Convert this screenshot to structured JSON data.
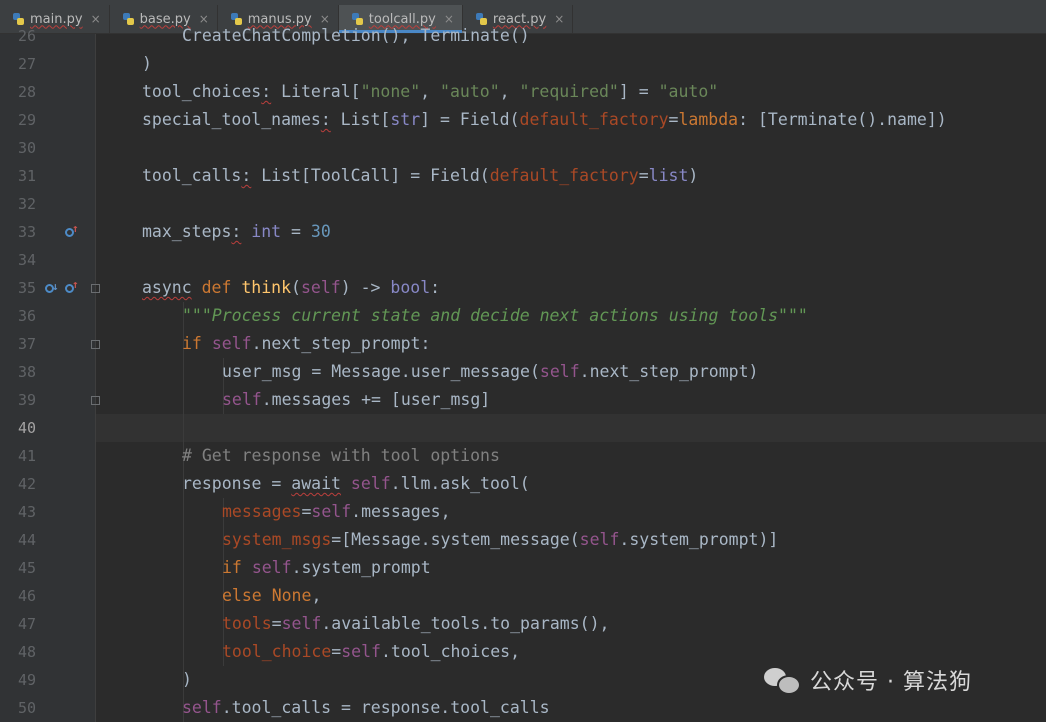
{
  "tabs": [
    {
      "label": "main.py",
      "active": false
    },
    {
      "label": "base.py",
      "active": false
    },
    {
      "label": "manus.py",
      "active": false
    },
    {
      "label": "toolcall.py",
      "active": true
    },
    {
      "label": "react.py",
      "active": false
    }
  ],
  "close_glyph": "×",
  "line_numbers": [
    "26",
    "27",
    "28",
    "29",
    "30",
    "31",
    "32",
    "33",
    "34",
    "35",
    "36",
    "37",
    "38",
    "39",
    "40",
    "41",
    "42",
    "43",
    "44",
    "45",
    "46",
    "47",
    "48",
    "49",
    "50"
  ],
  "current_line": "40",
  "watermark": {
    "text": "公众号 · 算法狗"
  },
  "colors": {
    "keyword": "#cc7832",
    "string": "#6a8759",
    "number": "#6897bb",
    "self": "#94558d",
    "kwarg": "#aa4926",
    "function": "#ffc66d",
    "comment": "#808080",
    "background": "#2b2b2b"
  }
}
